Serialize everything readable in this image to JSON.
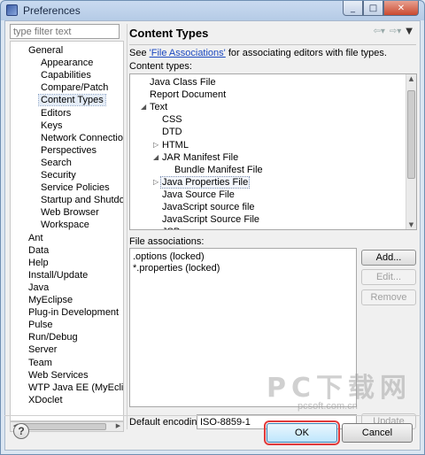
{
  "window": {
    "title": "Preferences",
    "controls": [
      "_",
      "□",
      "✕"
    ]
  },
  "filter": {
    "placeholder": "type filter text"
  },
  "nav_tree": [
    {
      "label": "General",
      "level": 0
    },
    {
      "label": "Appearance",
      "level": 1
    },
    {
      "label": "Capabilities",
      "level": 1
    },
    {
      "label": "Compare/Patch",
      "level": 1
    },
    {
      "label": "Content Types",
      "level": 1,
      "selected": true
    },
    {
      "label": "Editors",
      "level": 1
    },
    {
      "label": "Keys",
      "level": 1
    },
    {
      "label": "Network Connections",
      "level": 1
    },
    {
      "label": "Perspectives",
      "level": 1
    },
    {
      "label": "Search",
      "level": 1
    },
    {
      "label": "Security",
      "level": 1
    },
    {
      "label": "Service Policies",
      "level": 1
    },
    {
      "label": "Startup and Shutdown",
      "level": 1
    },
    {
      "label": "Web Browser",
      "level": 1
    },
    {
      "label": "Workspace",
      "level": 1
    },
    {
      "label": "Ant",
      "level": 0
    },
    {
      "label": "Data",
      "level": 0
    },
    {
      "label": "Help",
      "level": 0
    },
    {
      "label": "Install/Update",
      "level": 0
    },
    {
      "label": "Java",
      "level": 0
    },
    {
      "label": "MyEclipse",
      "level": 0
    },
    {
      "label": "Plug-in Development",
      "level": 0
    },
    {
      "label": "Pulse",
      "level": 0
    },
    {
      "label": "Run/Debug",
      "level": 0
    },
    {
      "label": "Server",
      "level": 0
    },
    {
      "label": "Team",
      "level": 0
    },
    {
      "label": "Web Services",
      "level": 0
    },
    {
      "label": "WTP Java EE (MyEclipse)",
      "level": 0
    },
    {
      "label": "XDoclet",
      "level": 0
    }
  ],
  "page": {
    "title": "Content Types",
    "desc_prefix": "See ",
    "desc_link": "'File Associations'",
    "desc_suffix": " for associating editors with file types.",
    "content_types_label": "Content types:",
    "file_assoc_label": "File associations:",
    "encoding_label": "Default encoding:",
    "encoding_value": "ISO-8859-1"
  },
  "content_types": [
    {
      "label": "Java Class File",
      "level": 0,
      "twisty": ""
    },
    {
      "label": "Report Document",
      "level": 0,
      "twisty": ""
    },
    {
      "label": "Text",
      "level": 0,
      "twisty": "◢"
    },
    {
      "label": "CSS",
      "level": 1,
      "twisty": ""
    },
    {
      "label": "DTD",
      "level": 1,
      "twisty": ""
    },
    {
      "label": "HTML",
      "level": 1,
      "twisty": "▷"
    },
    {
      "label": "JAR Manifest File",
      "level": 1,
      "twisty": "◢"
    },
    {
      "label": "Bundle Manifest File",
      "level": 2,
      "twisty": ""
    },
    {
      "label": "Java Properties File",
      "level": 1,
      "twisty": "▷",
      "selected": true
    },
    {
      "label": "Java Source File",
      "level": 1,
      "twisty": ""
    },
    {
      "label": "JavaScript source file",
      "level": 1,
      "twisty": ""
    },
    {
      "label": "JavaScript Source File",
      "level": 1,
      "twisty": ""
    },
    {
      "label": "JSP",
      "level": 1,
      "twisty": "▷"
    }
  ],
  "file_associations": [
    ".options (locked)",
    "*.properties (locked)"
  ],
  "buttons": {
    "add": "Add...",
    "edit": "Edit...",
    "remove": "Remove",
    "update": "Update",
    "ok": "OK",
    "cancel": "Cancel",
    "help": "?"
  },
  "watermark": {
    "text": "PC下载网",
    "url": "pcsoft.com.cn"
  },
  "colors": {
    "link": "#1a48c0",
    "highlight": "#e23a3a",
    "window_frame": "#6f8fb3"
  }
}
